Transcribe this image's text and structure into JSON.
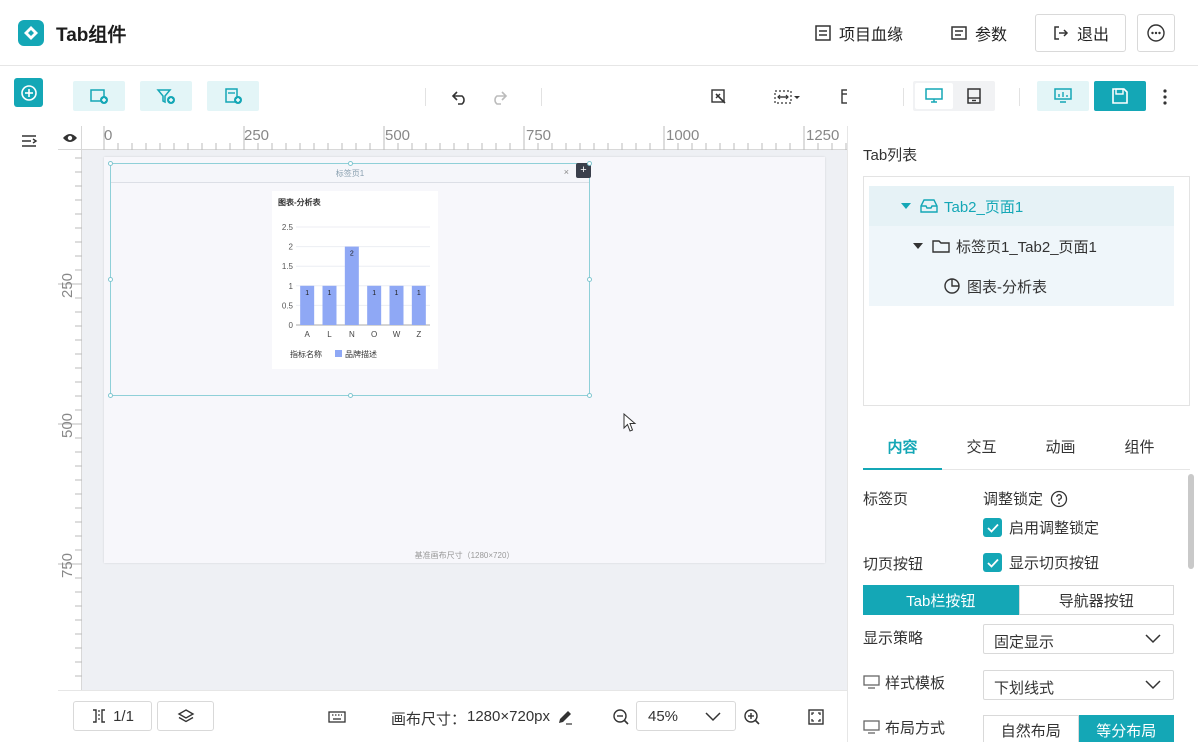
{
  "header": {
    "title": "Tab组件",
    "lineage_label": "项目血缘",
    "params_label": "参数",
    "exit_label": "退出"
  },
  "ruler": {
    "top_labels": [
      "0",
      "250",
      "500",
      "750",
      "1000",
      "1250"
    ],
    "left_labels": [
      "250",
      "500",
      "750"
    ]
  },
  "canvas": {
    "tab_label": "标签页1",
    "tab_close": "×",
    "tab_plus": "+",
    "footer_note": "基准画布尺寸（1280×720）"
  },
  "chart_data": {
    "type": "bar",
    "title": "图表-分析表",
    "categories": [
      "A",
      "L",
      "N",
      "O",
      "W",
      "Z"
    ],
    "values": [
      1,
      1,
      2,
      1,
      1,
      1
    ],
    "data_labels": [
      "1",
      "1",
      "2",
      "1",
      "1",
      "1"
    ],
    "y_ticks": [
      "0",
      "0.5",
      "1",
      "1.5",
      "2",
      "2.5"
    ],
    "ylim": [
      0,
      2.5
    ],
    "xlabel": "指标名称",
    "series": [
      {
        "name": "品牌描述",
        "values": [
          1,
          1,
          2,
          1,
          1,
          1
        ]
      }
    ],
    "legend": "bottom-left",
    "bar_color": "#8fa8f5"
  },
  "bottom": {
    "pages": "1/1",
    "canvas_size_label": "画布尺寸：",
    "canvas_size_value": "1280×720px",
    "zoom": "45%"
  },
  "panel": {
    "tree_title": "Tab列表",
    "tree": [
      {
        "label": "Tab2_页面1"
      },
      {
        "label": "标签页1_Tab2_页面1"
      },
      {
        "label": "图表-分析表"
      }
    ],
    "tabs": [
      "内容",
      "交互",
      "动画",
      "组件"
    ],
    "tab_section_label": "标签页",
    "adjust_lock_label": "调整锁定",
    "enable_lock_label": "启用调整锁定",
    "switch_btn_label": "切页按钮",
    "show_switch_label": "显示切页按钮",
    "seg_buttons": [
      "Tab栏按钮",
      "导航器按钮"
    ],
    "display_strategy_label": "显示策略",
    "display_strategy_value": "固定显示",
    "style_template_label": "样式模板",
    "style_template_value": "下划线式",
    "layout_label": "布局方式",
    "layout_buttons": [
      "自然布局",
      "等分布局"
    ]
  },
  "colors": {
    "accent": "#14a7b6"
  }
}
